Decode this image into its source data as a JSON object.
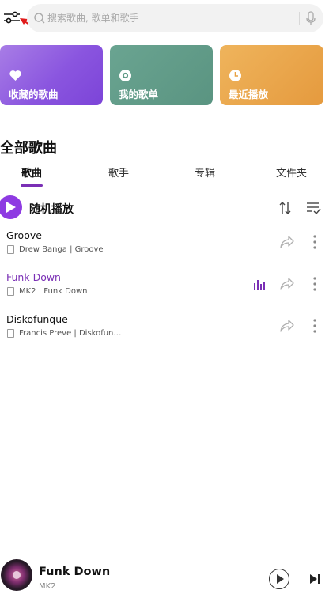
{
  "search": {
    "placeholder": "搜索歌曲, 歌单和歌手"
  },
  "shortcuts": [
    {
      "label": "收藏的歌曲",
      "icon": "heart-icon",
      "color": "#8a55df"
    },
    {
      "label": "我的歌单",
      "icon": "disc-icon",
      "color": "#5f9a86"
    },
    {
      "label": "最近播放",
      "icon": "clock-icon",
      "color": "#e8a244"
    }
  ],
  "section_title": "全部歌曲",
  "tabs": [
    {
      "label": "歌曲",
      "active": true
    },
    {
      "label": "歌手",
      "active": false
    },
    {
      "label": "专辑",
      "active": false
    },
    {
      "label": "文件夹",
      "active": false
    }
  ],
  "shuffle_label": "随机播放",
  "songs": [
    {
      "title": "Groove",
      "meta": "Drew Banga | Groove",
      "playing": false
    },
    {
      "title": "Funk Down",
      "meta": "MK2 | Funk Down",
      "playing": true
    },
    {
      "title": "Diskofunque",
      "meta": "Francis Preve | Diskofun…",
      "playing": false
    }
  ],
  "now_playing": {
    "title": "Funk Down",
    "artist": "MK2"
  },
  "colors": {
    "accent": "#7a2fb5",
    "play_button": "#8e3be2"
  }
}
